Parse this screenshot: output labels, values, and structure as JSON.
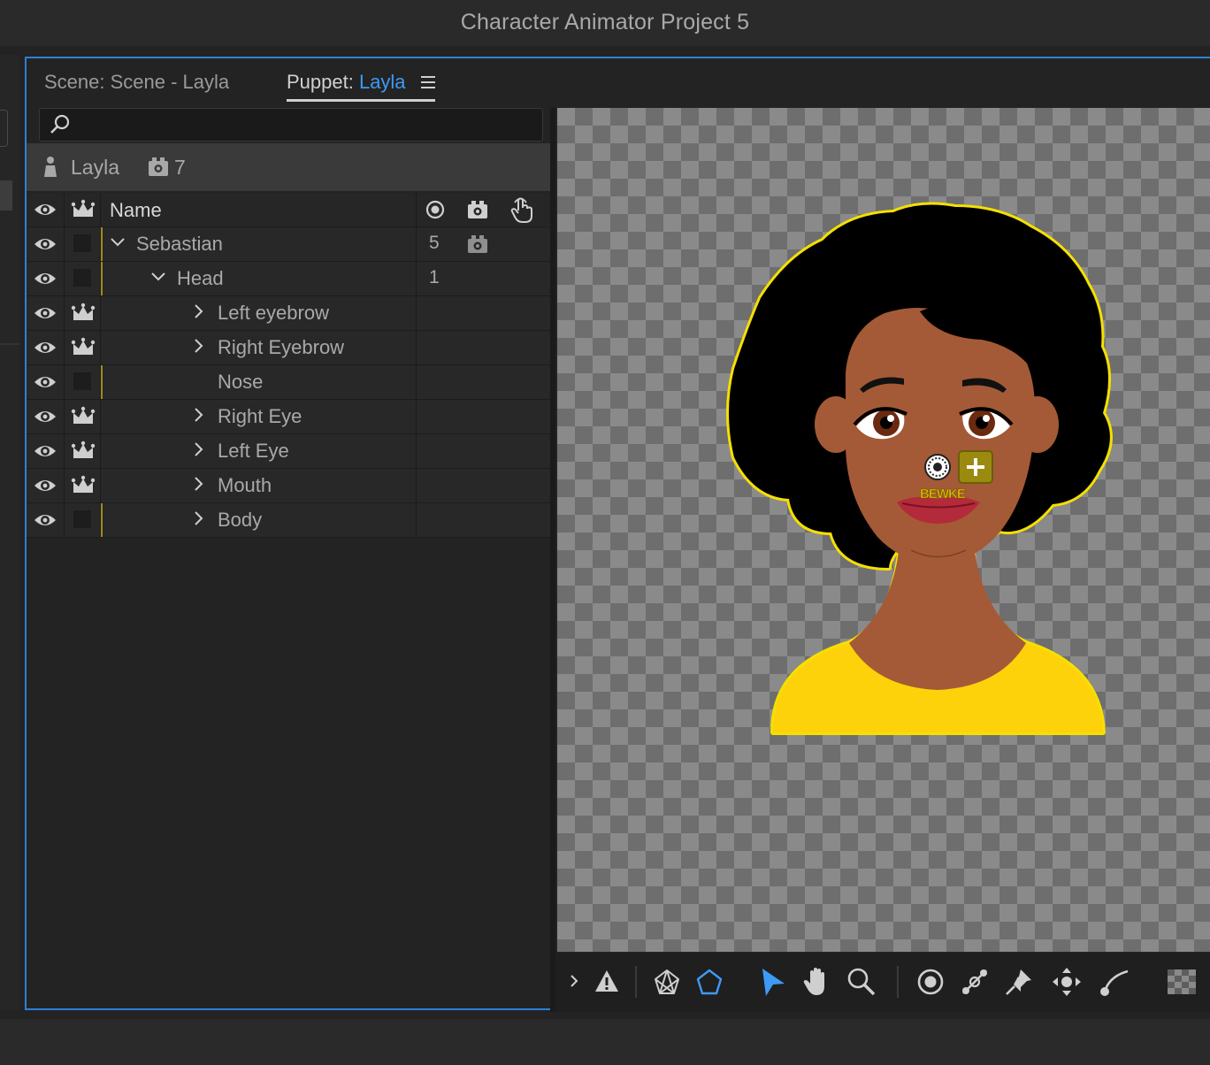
{
  "window": {
    "title": "Character Animator Project 5"
  },
  "tabs": {
    "scene_label": "Scene: Scene - Layla",
    "puppet_prefix": "Puppet: ",
    "puppet_name": "Layla"
  },
  "search": {
    "placeholder": "",
    "value": ""
  },
  "puppet_header": {
    "name": "Layla",
    "behavior_count": "7"
  },
  "table": {
    "columns": {
      "name": "Name"
    },
    "rows": [
      {
        "name": "Sebastian",
        "count": "5",
        "independent": false,
        "expand": "open",
        "indent": 0,
        "has_cam": true
      },
      {
        "name": "Head",
        "count": "1",
        "independent": false,
        "expand": "open",
        "indent": 1,
        "has_cam": false
      },
      {
        "name": "Left eyebrow",
        "count": "",
        "independent": true,
        "expand": "closed",
        "indent": 2,
        "has_cam": false
      },
      {
        "name": "Right Eyebrow",
        "count": "",
        "independent": true,
        "expand": "closed",
        "indent": 2,
        "has_cam": false
      },
      {
        "name": "Nose",
        "count": "",
        "independent": false,
        "expand": "none",
        "indent": 2,
        "has_cam": false
      },
      {
        "name": "Right Eye",
        "count": "",
        "independent": true,
        "expand": "closed",
        "indent": 2,
        "has_cam": false
      },
      {
        "name": "Left Eye",
        "count": "",
        "independent": true,
        "expand": "closed",
        "indent": 2,
        "has_cam": false
      },
      {
        "name": "Mouth",
        "count": "",
        "independent": true,
        "expand": "closed",
        "indent": 2,
        "has_cam": false
      },
      {
        "name": "Body",
        "count": "",
        "independent": false,
        "expand": "closed",
        "indent": 2,
        "has_cam": false
      }
    ]
  },
  "canvas": {
    "label_on_face": "BEWKE"
  },
  "toolbar": {
    "icons": [
      "expand-chevron-icon",
      "warning-icon",
      "mesh-icon",
      "polygon-icon",
      "select-arrow-icon",
      "hand-icon",
      "zoom-icon",
      "origin-handle-icon",
      "stick-tool-icon",
      "pin-icon",
      "dragger-icon",
      "draw-path-icon",
      "checkerboard-icon"
    ],
    "active": "select-arrow-icon"
  },
  "colors": {
    "accent_blue": "#2f7fd8",
    "selection_yellow": "#f5e000",
    "shirt": "#fdd20a",
    "skin": "#a45a36",
    "hair": "#000000"
  }
}
